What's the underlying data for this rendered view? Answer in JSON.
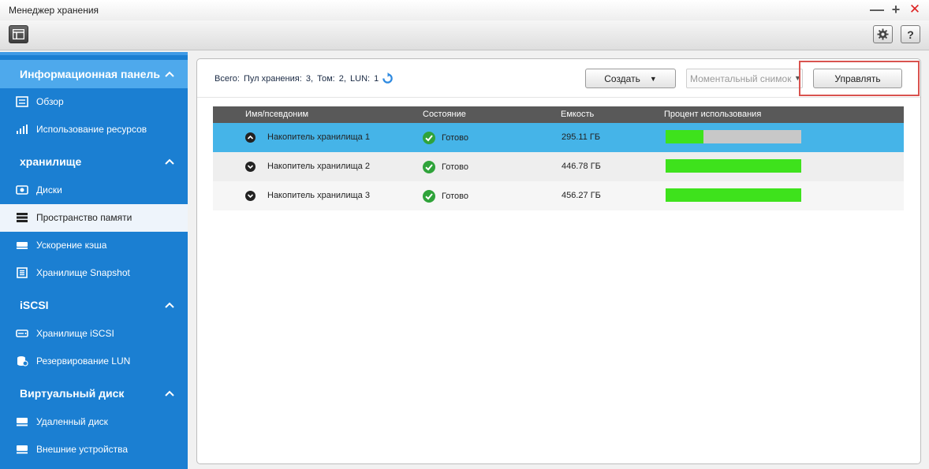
{
  "window": {
    "title": "Менеджер хранения",
    "minimize": "—",
    "maximize": "+",
    "close": "✕"
  },
  "toolbar": {
    "help": "?"
  },
  "sidebar": {
    "sections": [
      {
        "label": "Информационная панель",
        "items": [
          {
            "label": "Обзор",
            "icon": "overview-icon"
          },
          {
            "label": "Использование ресурсов",
            "icon": "resource-usage-icon"
          }
        ]
      },
      {
        "label": "хранилище",
        "items": [
          {
            "label": "Диски",
            "icon": "disk-icon"
          },
          {
            "label": "Пространство памяти",
            "icon": "storage-space-icon"
          },
          {
            "label": "Ускорение кэша",
            "icon": "cache-icon"
          },
          {
            "label": "Хранилище Snapshot",
            "icon": "snapshot-icon"
          }
        ]
      },
      {
        "label": "iSCSI",
        "items": [
          {
            "label": "Хранилище iSCSI",
            "icon": "iscsi-icon"
          },
          {
            "label": "Резервирование LUN",
            "icon": "lun-backup-icon"
          }
        ]
      },
      {
        "label": "Виртуальный диск",
        "items": [
          {
            "label": "Удаленный диск",
            "icon": "remote-disk-icon"
          },
          {
            "label": "Внешние устройства",
            "icon": "external-device-icon"
          }
        ]
      }
    ],
    "active": "Пространство памяти"
  },
  "summary": {
    "total_label": "Всего:",
    "pool_label": "Пул хранения:",
    "pool_count": "3,",
    "volume_label": "Том:",
    "volume_count": "2,",
    "lun_label": "LUN:",
    "lun_count": "1"
  },
  "actions": {
    "create_label": "Создать",
    "snapshot_placeholder": "Моментальный снимок",
    "manage_label": "Управлять"
  },
  "table": {
    "columns": {
      "name": "Имя/псевдоним",
      "status": "Состояние",
      "capacity": "Емкость",
      "usage": "Процент использования"
    },
    "rows": [
      {
        "name": "Накопитель хранилища 1",
        "status": "Готово",
        "capacity": "295.11 ГБ",
        "usage_fraction": 0.28,
        "expanded": true,
        "selected": true
      },
      {
        "name": "Накопитель хранилища 2",
        "status": "Готово",
        "capacity": "446.78 ГБ",
        "usage_fraction": 1.0,
        "expanded": false,
        "selected": false
      },
      {
        "name": "Накопитель хранилища 3",
        "status": "Готово",
        "capacity": "456.27 ГБ",
        "usage_fraction": 1.0,
        "expanded": false,
        "selected": false
      }
    ]
  },
  "colors": {
    "sidebar_bg": "#1b7fd2",
    "sidebar_section_active": "#4ea9ec",
    "selected_row": "#45b4e8",
    "usage_fill": "#3ee21c",
    "usage_track": "#c8c8c8",
    "highlight_border": "#d9534f"
  }
}
